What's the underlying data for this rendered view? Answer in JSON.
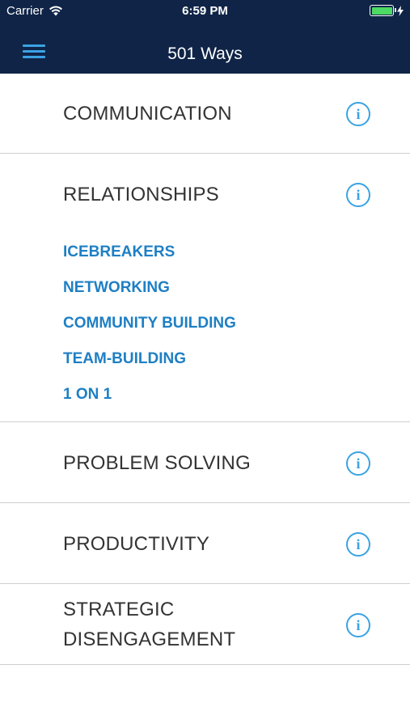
{
  "status_bar": {
    "carrier": "Carrier",
    "time": "6:59 PM",
    "battery_level": 1.0
  },
  "nav": {
    "title": "501 Ways"
  },
  "colors": {
    "navbar_bg": "#0f2447",
    "accent": "#3aa3e3",
    "subitem_text": "#1e7fc4",
    "battery": "#4cd964"
  },
  "categories": [
    {
      "title": "COMMUNICATION",
      "info_icon": "info-icon"
    },
    {
      "title": "RELATIONSHIPS",
      "info_icon": "info-icon",
      "subitems": [
        "ICEBREAKERS",
        "NETWORKING",
        "COMMUNITY BUILDING",
        "TEAM-BUILDING",
        "1 ON 1"
      ]
    },
    {
      "title": "PROBLEM SOLVING",
      "info_icon": "info-icon"
    },
    {
      "title": "PRODUCTIVITY",
      "info_icon": "info-icon"
    },
    {
      "title": "STRATEGIC DISENGAGEMENT",
      "info_icon": "info-icon"
    }
  ]
}
